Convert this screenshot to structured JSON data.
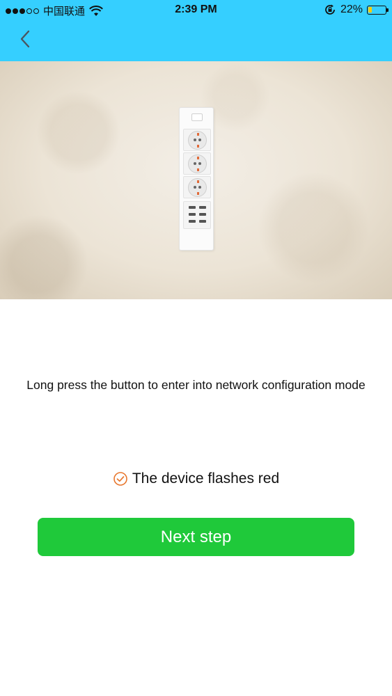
{
  "status_bar": {
    "carrier": "中国联通",
    "time": "2:39 PM",
    "battery_percent": "22%",
    "battery_level": 0.22,
    "battery_color": "#ffcc00"
  },
  "nav": {
    "back_icon": "chevron-left-icon",
    "background_color": "#35cfff"
  },
  "hero": {
    "image": "power-strip-illustration"
  },
  "main": {
    "instruction": "Long press the button to enter into network configuration mode",
    "confirm_label": "The device flashes red",
    "confirm_icon": "check-circle-icon",
    "confirm_checked": true,
    "next_button_label": "Next step",
    "next_button_color": "#1fc93a"
  }
}
